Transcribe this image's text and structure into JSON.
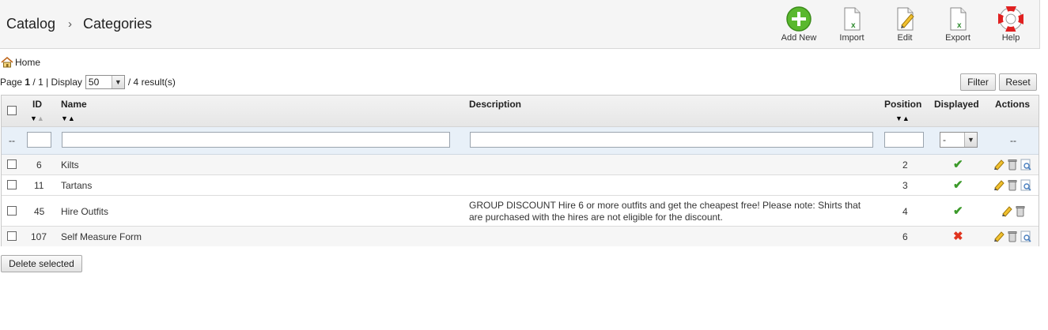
{
  "breadcrumb": {
    "section": "Catalog",
    "separator": "›",
    "page": "Categories"
  },
  "toolbar": {
    "add_new": "Add New",
    "import": "Import",
    "edit": "Edit",
    "export": "Export",
    "help": "Help"
  },
  "home_link": "Home",
  "pagination": {
    "prefix": "Page",
    "current": "1",
    "total": "/ 1",
    "display_label": "| Display",
    "per_page": "50",
    "results": "/ 4 result(s)"
  },
  "buttons": {
    "filter": "Filter",
    "reset": "Reset",
    "delete_selected": "Delete selected"
  },
  "columns": {
    "id": "ID",
    "name": "Name",
    "description": "Description",
    "position": "Position",
    "displayed": "Displayed",
    "actions": "Actions"
  },
  "filters": {
    "id_prefix": "--",
    "displayed_value": "-",
    "actions_placeholder": "--"
  },
  "rows": [
    {
      "id": "6",
      "name": "Kilts",
      "description_line1": "",
      "description_line2": "",
      "position": "2",
      "displayed": true
    },
    {
      "id": "11",
      "name": "Tartans",
      "description_line1": "",
      "description_line2": "",
      "position": "3",
      "displayed": true
    },
    {
      "id": "45",
      "name": "Hire Outfits",
      "description_line1": "GROUP DISCOUNT Hire 6 or more outfits and get the cheapest free! Please note: Shirts that",
      "description_line2": "are purchased with the hires are not eligible for the discount.",
      "position": "4",
      "displayed": true
    },
    {
      "id": "107",
      "name": "Self Measure Form",
      "description_line1": "",
      "description_line2": "",
      "position": "6",
      "displayed": false
    }
  ],
  "glyphs": {
    "yes": "✔",
    "no": "✖",
    "sort_desc": "▼",
    "sort_asc": "▲",
    "select_arrow": "▼"
  },
  "colors": {
    "accent_green": "#3c9a2a",
    "error_red": "#e0341f",
    "filter_row": "#e8f0f8"
  }
}
